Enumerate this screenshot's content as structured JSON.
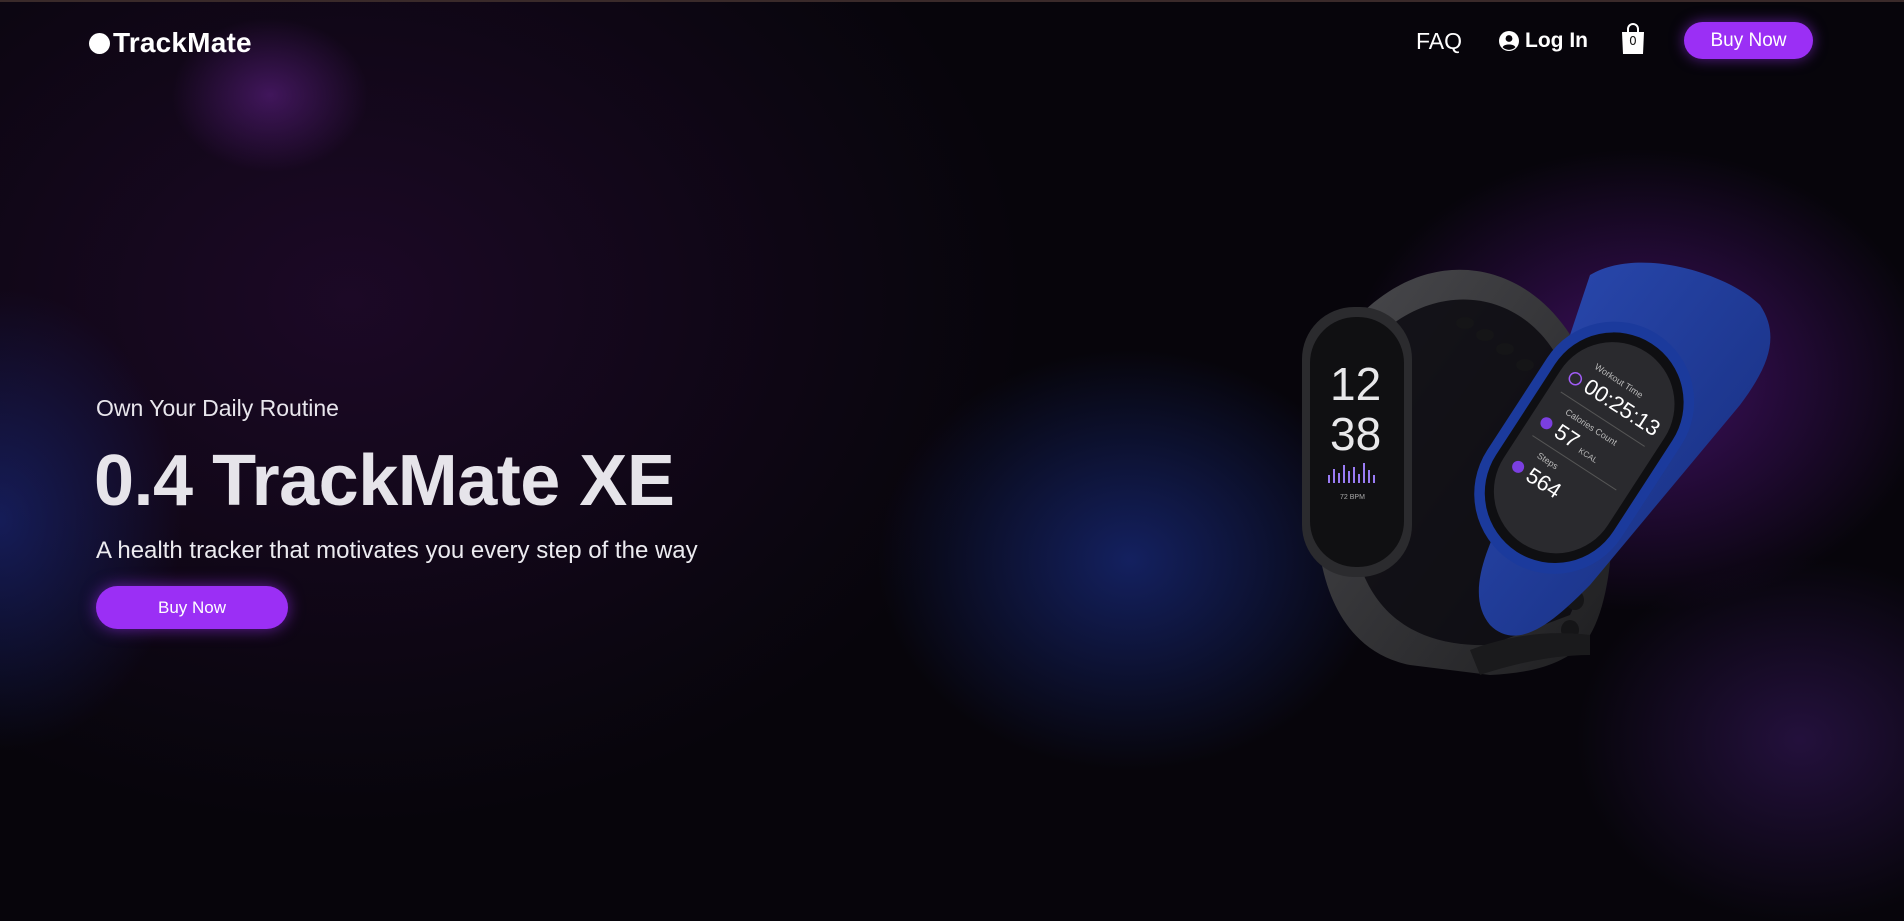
{
  "brand": {
    "name": "TrackMate"
  },
  "nav": {
    "faq_label": "FAQ",
    "login_label": "Log In",
    "cart_count": "0",
    "buy_label": "Buy Now"
  },
  "hero": {
    "eyebrow": "Own Your Daily Routine",
    "title": "0.4 TrackMate XE",
    "subtitle": "A health tracker that motivates you every step of the way",
    "cta_label": "Buy Now"
  },
  "product_image": {
    "black_band": {
      "hour": "12",
      "minute": "38",
      "bpm": "72 BPM"
    },
    "blue_band": {
      "workout_label": "Workout Time",
      "workout_value": "00:25:13",
      "calories_label": "Calories Count",
      "calories_value": "57",
      "calories_unit": "KCAL",
      "steps_label": "Steps",
      "steps_value": "564"
    }
  },
  "colors": {
    "accent": "#9b2ff5",
    "background": "#07050b",
    "band_black": "#2e2e31",
    "band_blue": "#1f3a96"
  }
}
